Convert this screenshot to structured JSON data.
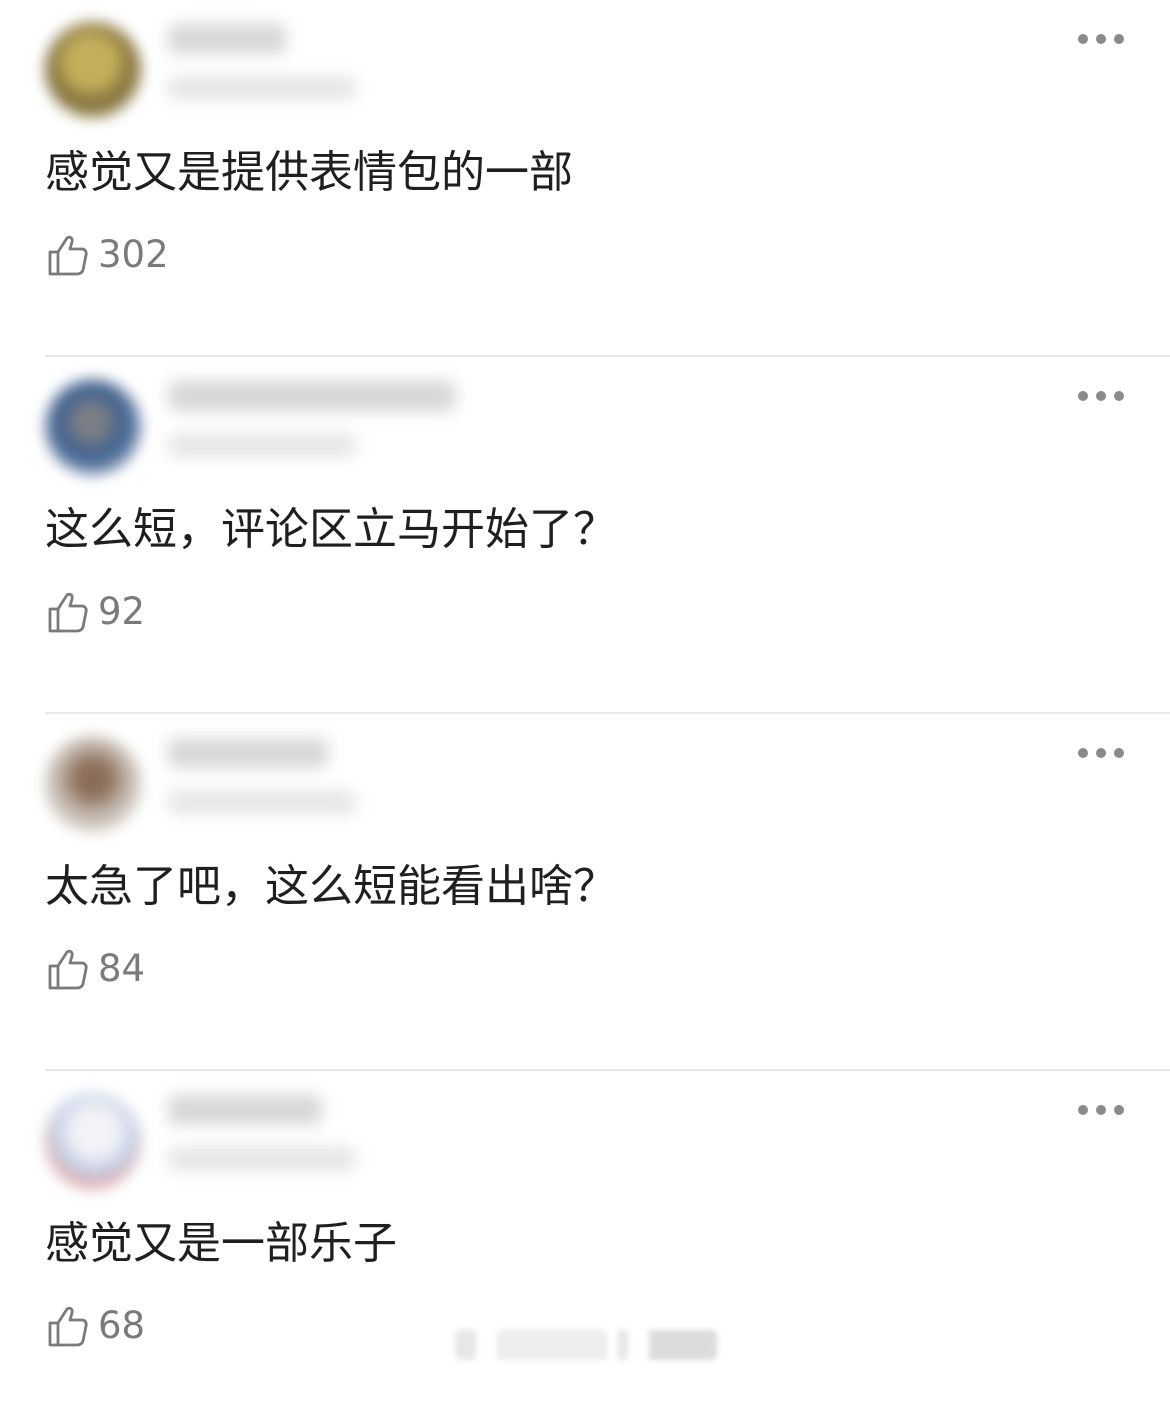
{
  "comments": [
    {
      "text": "感觉又是提供表情包的一部",
      "likes": "302",
      "avatar_color": "#9a8a45"
    },
    {
      "text": "这么短，评论区立马开始了？",
      "likes": "92",
      "avatar_color": "#4e617a"
    },
    {
      "text": "太急了吧，这么短能看出啥？",
      "likes": "84",
      "avatar_color": "#8f7d6f"
    },
    {
      "text": "感觉又是一部乐子",
      "likes": "68",
      "avatar_color": "#d7dde8"
    }
  ],
  "icons": {
    "like": "thumb-up-icon",
    "more": "more-options-icon"
  },
  "colors": {
    "text": "#1f1f1f",
    "muted": "#7a7a7a",
    "divider": "#e8e8e8"
  }
}
